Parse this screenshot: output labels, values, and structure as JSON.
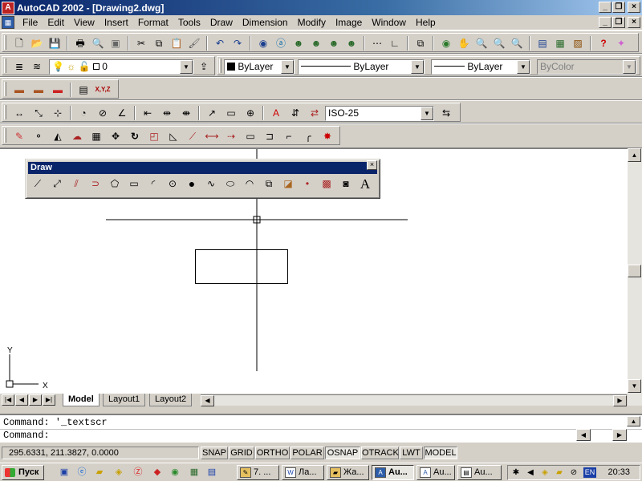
{
  "window": {
    "title": "AutoCAD 2002 - [Drawing2.dwg]"
  },
  "menu": [
    "File",
    "Edit",
    "View",
    "Insert",
    "Format",
    "Tools",
    "Draw",
    "Dimension",
    "Modify",
    "Image",
    "Window",
    "Help"
  ],
  "layer_toolbar": {
    "layer_name": "0",
    "color": "ByLayer",
    "linetype": "ByLayer",
    "lineweight": "ByLayer",
    "plotstyle": "ByColor"
  },
  "dim_toolbar": {
    "dimstyle": "ISO-25"
  },
  "refedit_toolbar": {
    "xyz_label": "X,Y,Z"
  },
  "draw_toolbar": {
    "title": "Draw",
    "text_tool": "A"
  },
  "ucs": {
    "x_label": "X",
    "y_label": "Y"
  },
  "tabs": [
    "Model",
    "Layout1",
    "Layout2"
  ],
  "command": {
    "history": "Command:  '_textscr",
    "prompt": "Command:"
  },
  "status": {
    "coords": "295.6331, 211.3827, 0.0000",
    "toggles": [
      "SNAP",
      "GRID",
      "ORTHO",
      "POLAR",
      "OSNAP",
      "OTRACK",
      "LWT",
      "MODEL"
    ],
    "toggles_on": [
      "OSNAP",
      "MODEL"
    ]
  },
  "taskbar": {
    "start": "Пуск",
    "buttons": [
      "7. ...",
      "Ла...",
      "Жа...",
      "Au...",
      "Au...",
      "Au..."
    ],
    "active_index": 3,
    "lang": "EN",
    "clock": "20:33"
  }
}
